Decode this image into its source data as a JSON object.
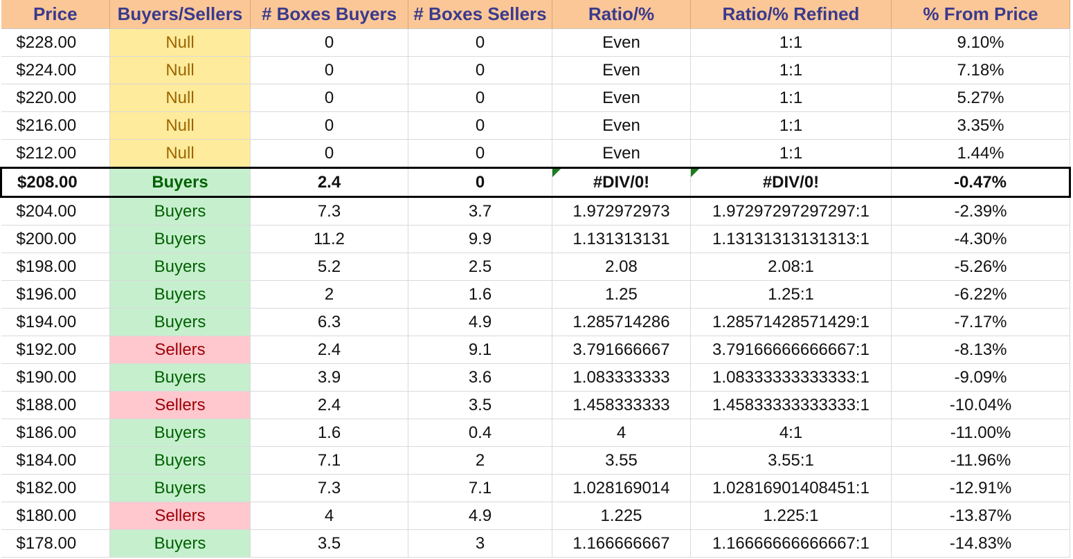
{
  "headers": [
    "Price",
    "Buyers/Sellers",
    "# Boxes Buyers",
    "# Boxes Sellers",
    "Ratio/%",
    "Ratio/% Refined",
    "% From Price"
  ],
  "colors": {
    "header_bg": "#fcc797",
    "header_text": "#3a3a8c",
    "null_bg": "#ffeb9c",
    "null_text": "#9c6500",
    "buyers_bg": "#c6efce",
    "buyers_text": "#006100",
    "sellers_bg": "#ffc7ce",
    "sellers_text": "#9c0006"
  },
  "rows": [
    {
      "price": "$228.00",
      "side": "Null",
      "boxes_buyers": "0",
      "boxes_sellers": "0",
      "ratio": "Even",
      "ratio_refined": "1:1",
      "from_price": "9.10%"
    },
    {
      "price": "$224.00",
      "side": "Null",
      "boxes_buyers": "0",
      "boxes_sellers": "0",
      "ratio": "Even",
      "ratio_refined": "1:1",
      "from_price": "7.18%"
    },
    {
      "price": "$220.00",
      "side": "Null",
      "boxes_buyers": "0",
      "boxes_sellers": "0",
      "ratio": "Even",
      "ratio_refined": "1:1",
      "from_price": "5.27%"
    },
    {
      "price": "$216.00",
      "side": "Null",
      "boxes_buyers": "0",
      "boxes_sellers": "0",
      "ratio": "Even",
      "ratio_refined": "1:1",
      "from_price": "3.35%"
    },
    {
      "price": "$212.00",
      "side": "Null",
      "boxes_buyers": "0",
      "boxes_sellers": "0",
      "ratio": "Even",
      "ratio_refined": "1:1",
      "from_price": "1.44%"
    },
    {
      "price": "$208.00",
      "side": "Buyers",
      "boxes_buyers": "2.4",
      "boxes_sellers": "0",
      "ratio": "#DIV/0!",
      "ratio_refined": "#DIV/0!",
      "from_price": "-0.47%",
      "current": true
    },
    {
      "price": "$204.00",
      "side": "Buyers",
      "boxes_buyers": "7.3",
      "boxes_sellers": "3.7",
      "ratio": "1.972972973",
      "ratio_refined": "1.97297297297297:1",
      "from_price": "-2.39%"
    },
    {
      "price": "$200.00",
      "side": "Buyers",
      "boxes_buyers": "11.2",
      "boxes_sellers": "9.9",
      "ratio": "1.131313131",
      "ratio_refined": "1.13131313131313:1",
      "from_price": "-4.30%"
    },
    {
      "price": "$198.00",
      "side": "Buyers",
      "boxes_buyers": "5.2",
      "boxes_sellers": "2.5",
      "ratio": "2.08",
      "ratio_refined": "2.08:1",
      "from_price": "-5.26%"
    },
    {
      "price": "$196.00",
      "side": "Buyers",
      "boxes_buyers": "2",
      "boxes_sellers": "1.6",
      "ratio": "1.25",
      "ratio_refined": "1.25:1",
      "from_price": "-6.22%"
    },
    {
      "price": "$194.00",
      "side": "Buyers",
      "boxes_buyers": "6.3",
      "boxes_sellers": "4.9",
      "ratio": "1.285714286",
      "ratio_refined": "1.28571428571429:1",
      "from_price": "-7.17%"
    },
    {
      "price": "$192.00",
      "side": "Sellers",
      "boxes_buyers": "2.4",
      "boxes_sellers": "9.1",
      "ratio": "3.791666667",
      "ratio_refined": "3.79166666666667:1",
      "from_price": "-8.13%"
    },
    {
      "price": "$190.00",
      "side": "Buyers",
      "boxes_buyers": "3.9",
      "boxes_sellers": "3.6",
      "ratio": "1.083333333",
      "ratio_refined": "1.08333333333333:1",
      "from_price": "-9.09%"
    },
    {
      "price": "$188.00",
      "side": "Sellers",
      "boxes_buyers": "2.4",
      "boxes_sellers": "3.5",
      "ratio": "1.458333333",
      "ratio_refined": "1.45833333333333:1",
      "from_price": "-10.04%"
    },
    {
      "price": "$186.00",
      "side": "Buyers",
      "boxes_buyers": "1.6",
      "boxes_sellers": "0.4",
      "ratio": "4",
      "ratio_refined": "4:1",
      "from_price": "-11.00%"
    },
    {
      "price": "$184.00",
      "side": "Buyers",
      "boxes_buyers": "7.1",
      "boxes_sellers": "2",
      "ratio": "3.55",
      "ratio_refined": "3.55:1",
      "from_price": "-11.96%"
    },
    {
      "price": "$182.00",
      "side": "Buyers",
      "boxes_buyers": "7.3",
      "boxes_sellers": "7.1",
      "ratio": "1.028169014",
      "ratio_refined": "1.02816901408451:1",
      "from_price": "-12.91%"
    },
    {
      "price": "$180.00",
      "side": "Sellers",
      "boxes_buyers": "4",
      "boxes_sellers": "4.9",
      "ratio": "1.225",
      "ratio_refined": "1.225:1",
      "from_price": "-13.87%"
    },
    {
      "price": "$178.00",
      "side": "Buyers",
      "boxes_buyers": "3.5",
      "boxes_sellers": "3",
      "ratio": "1.166666667",
      "ratio_refined": "1.16666666666667:1",
      "from_price": "-14.83%"
    }
  ]
}
